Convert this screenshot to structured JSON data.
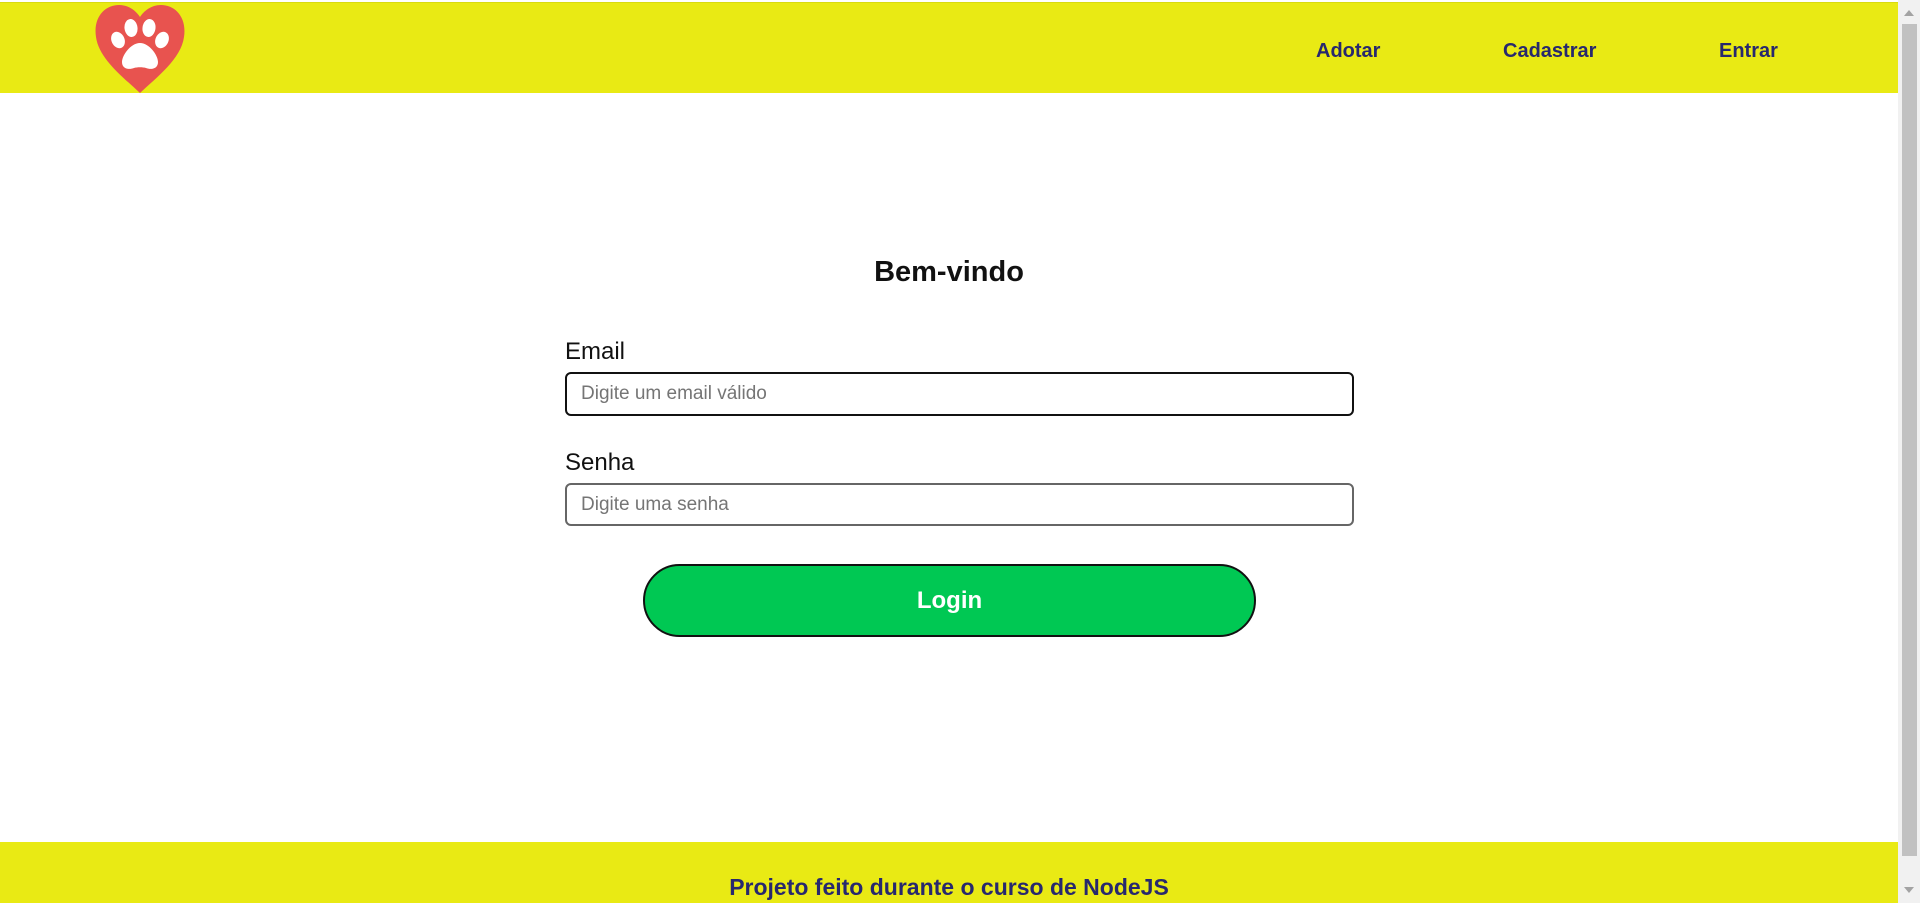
{
  "navbar": {
    "logo_icon": "heart-paw-logo-icon",
    "links": [
      {
        "label": "Adotar"
      },
      {
        "label": "Cadastrar"
      },
      {
        "label": "Entrar"
      }
    ]
  },
  "login": {
    "title": "Bem-vindo",
    "email_label": "Email",
    "email_placeholder": "Digite um email válido",
    "email_value": "",
    "password_label": "Senha",
    "password_placeholder": "Digite uma senha",
    "password_value": "",
    "submit_label": "Login"
  },
  "footer": {
    "text": "Projeto feito durante o curso de NodeJS"
  },
  "colors": {
    "bar": "#e9ea14",
    "link": "#27286e",
    "button": "#00c853",
    "logo_heart": "#e8534f"
  }
}
